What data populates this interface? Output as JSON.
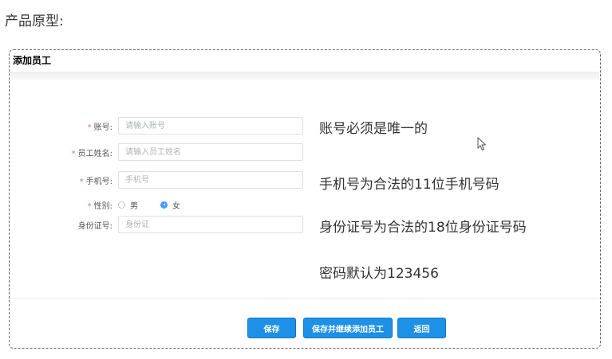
{
  "page": {
    "heading": "产品原型:"
  },
  "card": {
    "title": "添加员工"
  },
  "form": {
    "required_mark": "*",
    "account": {
      "label": "账号:",
      "placeholder": "请输入账号",
      "value": ""
    },
    "name": {
      "label": "员工姓名:",
      "placeholder": "请输入员工姓名",
      "value": ""
    },
    "phone": {
      "label": "手机号:",
      "placeholder": "手机号",
      "value": ""
    },
    "gender": {
      "label": "性别:",
      "options": [
        "男",
        "女"
      ],
      "selected": "女"
    },
    "id_card": {
      "label": "身份证号:",
      "placeholder": "身份证",
      "value": ""
    }
  },
  "notes": {
    "account": "账号必须是唯一的",
    "phone": "手机号为合法的11位手机号码",
    "id_card": "身份证号为合法的18位身份证号码",
    "password": "密码默认为123456"
  },
  "buttons": {
    "save": "保存",
    "save_continue": "保存并继续添加员工",
    "back": "返回"
  },
  "colors": {
    "primary_button": "#1e90e6",
    "required": "#f56c6c",
    "radio_checked": "#409eff"
  },
  "icons": {
    "cursor": "mouse-pointer-icon"
  }
}
